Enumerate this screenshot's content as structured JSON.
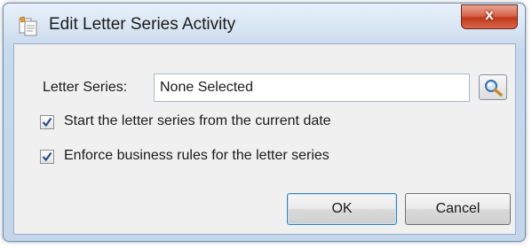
{
  "window": {
    "title": "Edit Letter Series Activity",
    "close_label": "x"
  },
  "form": {
    "letter_series_label": "Letter Series:",
    "letter_series_value": "None Selected",
    "lookup_icon": "magnifier-icon"
  },
  "options": [
    {
      "label": "Start the letter series from the current date",
      "checked": true
    },
    {
      "label": "Enforce business rules for the letter series",
      "checked": true
    }
  ],
  "buttons": {
    "ok_label": "OK",
    "cancel_label": "Cancel"
  },
  "colors": {
    "title_bar": "#d6e4f2",
    "close_button": "#c2391c",
    "client_area": "#f0f0f0",
    "check_mark": "#2b4f8a"
  }
}
